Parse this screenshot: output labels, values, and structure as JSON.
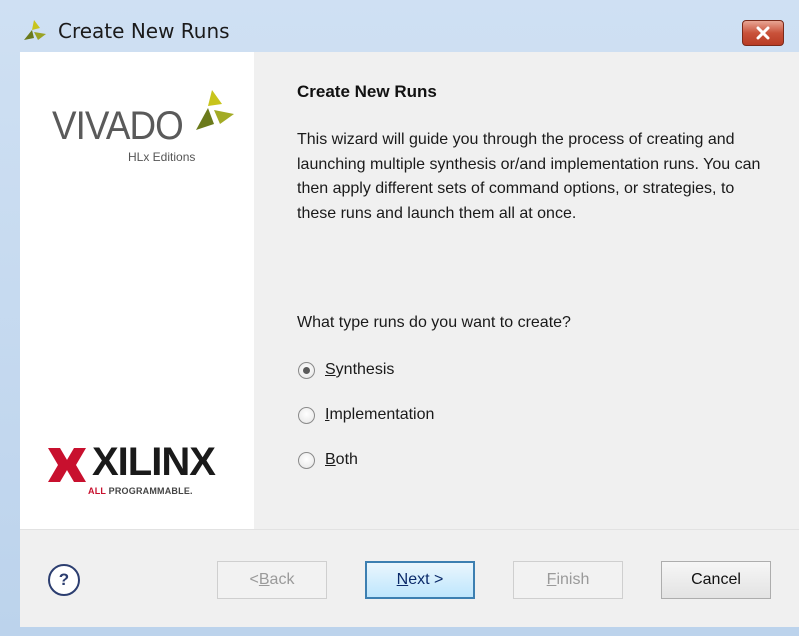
{
  "window": {
    "title": "Create New Runs",
    "close_icon": "close-icon",
    "title_icon": "vivado-leaf-icon"
  },
  "sidebar": {
    "vivado_logo_text": "VIVADO",
    "vivado_subtitle": "HLx Editions",
    "xilinx_logo_text": "XILINX",
    "xilinx_tagline_a": "ALL ",
    "xilinx_tagline_b": "PROGRAMMABLE."
  },
  "content": {
    "heading": "Create New Runs",
    "description": "This wizard will guide you through the process of creating and launching multiple synthesis or/and implementation runs. You can then apply different sets of command options, or strategies, to these runs and launch them all at once.",
    "question": "What type runs do you want to create?",
    "options": [
      {
        "key": "S",
        "rest": "ynthesis",
        "checked": true
      },
      {
        "key": "I",
        "rest": "mplementation",
        "checked": false
      },
      {
        "key": "B",
        "rest": "oth",
        "checked": false
      }
    ]
  },
  "footer": {
    "help_label": "?",
    "back": {
      "prefix": "< ",
      "key": "B",
      "rest": "ack"
    },
    "next": {
      "key": "N",
      "rest": "ext >"
    },
    "finish": {
      "key": "F",
      "rest": "inish"
    },
    "cancel": "Cancel"
  },
  "colors": {
    "accent": "#3c7fb1",
    "xilinx_red": "#c8102e",
    "vivado_leaf_dark": "#6b7a1b",
    "vivado_leaf_light": "#c8c41c"
  }
}
